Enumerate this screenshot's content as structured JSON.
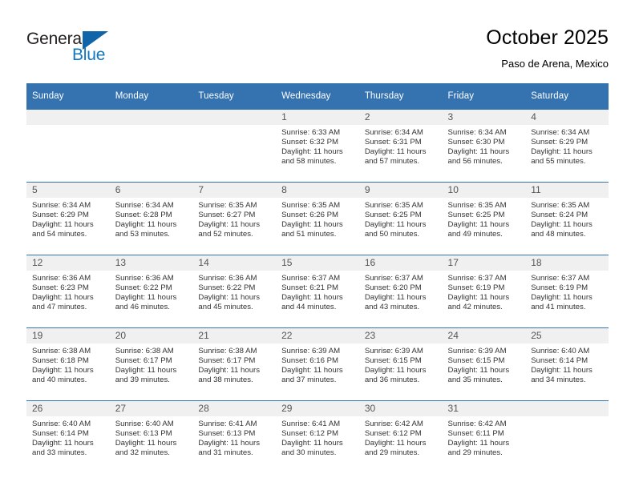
{
  "brand": {
    "name_part1": "General",
    "name_part2": "Blue",
    "triangle_icon": "triangle-logo-icon",
    "accent_color": "#1064a8",
    "blue_text_color": "#1278be"
  },
  "header": {
    "title": "October 2025",
    "subtitle": "Paso de Arena, Mexico",
    "header_bg_color": "#3572b0",
    "daynum_band_color": "#f0f0f0"
  },
  "weekday_headers": [
    "Sunday",
    "Monday",
    "Tuesday",
    "Wednesday",
    "Thursday",
    "Friday",
    "Saturday"
  ],
  "labels": {
    "sunrise_prefix": "Sunrise:",
    "sunset_prefix": "Sunset:",
    "daylight_prefix": "Daylight:"
  },
  "weeks": [
    [
      {
        "day": "",
        "empty": true,
        "sunrise": "",
        "sunset": "",
        "daylight_line1": "",
        "daylight_line2": ""
      },
      {
        "day": "",
        "empty": true,
        "sunrise": "",
        "sunset": "",
        "daylight_line1": "",
        "daylight_line2": ""
      },
      {
        "day": "",
        "empty": true,
        "sunrise": "",
        "sunset": "",
        "daylight_line1": "",
        "daylight_line2": ""
      },
      {
        "day": "1",
        "empty": false,
        "sunrise": "Sunrise: 6:33 AM",
        "sunset": "Sunset: 6:32 PM",
        "daylight_line1": "Daylight: 11 hours",
        "daylight_line2": "and 58 minutes."
      },
      {
        "day": "2",
        "empty": false,
        "sunrise": "Sunrise: 6:34 AM",
        "sunset": "Sunset: 6:31 PM",
        "daylight_line1": "Daylight: 11 hours",
        "daylight_line2": "and 57 minutes."
      },
      {
        "day": "3",
        "empty": false,
        "sunrise": "Sunrise: 6:34 AM",
        "sunset": "Sunset: 6:30 PM",
        "daylight_line1": "Daylight: 11 hours",
        "daylight_line2": "and 56 minutes."
      },
      {
        "day": "4",
        "empty": false,
        "sunrise": "Sunrise: 6:34 AM",
        "sunset": "Sunset: 6:29 PM",
        "daylight_line1": "Daylight: 11 hours",
        "daylight_line2": "and 55 minutes."
      }
    ],
    [
      {
        "day": "5",
        "empty": false,
        "sunrise": "Sunrise: 6:34 AM",
        "sunset": "Sunset: 6:29 PM",
        "daylight_line1": "Daylight: 11 hours",
        "daylight_line2": "and 54 minutes."
      },
      {
        "day": "6",
        "empty": false,
        "sunrise": "Sunrise: 6:34 AM",
        "sunset": "Sunset: 6:28 PM",
        "daylight_line1": "Daylight: 11 hours",
        "daylight_line2": "and 53 minutes."
      },
      {
        "day": "7",
        "empty": false,
        "sunrise": "Sunrise: 6:35 AM",
        "sunset": "Sunset: 6:27 PM",
        "daylight_line1": "Daylight: 11 hours",
        "daylight_line2": "and 52 minutes."
      },
      {
        "day": "8",
        "empty": false,
        "sunrise": "Sunrise: 6:35 AM",
        "sunset": "Sunset: 6:26 PM",
        "daylight_line1": "Daylight: 11 hours",
        "daylight_line2": "and 51 minutes."
      },
      {
        "day": "9",
        "empty": false,
        "sunrise": "Sunrise: 6:35 AM",
        "sunset": "Sunset: 6:25 PM",
        "daylight_line1": "Daylight: 11 hours",
        "daylight_line2": "and 50 minutes."
      },
      {
        "day": "10",
        "empty": false,
        "sunrise": "Sunrise: 6:35 AM",
        "sunset": "Sunset: 6:25 PM",
        "daylight_line1": "Daylight: 11 hours",
        "daylight_line2": "and 49 minutes."
      },
      {
        "day": "11",
        "empty": false,
        "sunrise": "Sunrise: 6:35 AM",
        "sunset": "Sunset: 6:24 PM",
        "daylight_line1": "Daylight: 11 hours",
        "daylight_line2": "and 48 minutes."
      }
    ],
    [
      {
        "day": "12",
        "empty": false,
        "sunrise": "Sunrise: 6:36 AM",
        "sunset": "Sunset: 6:23 PM",
        "daylight_line1": "Daylight: 11 hours",
        "daylight_line2": "and 47 minutes."
      },
      {
        "day": "13",
        "empty": false,
        "sunrise": "Sunrise: 6:36 AM",
        "sunset": "Sunset: 6:22 PM",
        "daylight_line1": "Daylight: 11 hours",
        "daylight_line2": "and 46 minutes."
      },
      {
        "day": "14",
        "empty": false,
        "sunrise": "Sunrise: 6:36 AM",
        "sunset": "Sunset: 6:22 PM",
        "daylight_line1": "Daylight: 11 hours",
        "daylight_line2": "and 45 minutes."
      },
      {
        "day": "15",
        "empty": false,
        "sunrise": "Sunrise: 6:37 AM",
        "sunset": "Sunset: 6:21 PM",
        "daylight_line1": "Daylight: 11 hours",
        "daylight_line2": "and 44 minutes."
      },
      {
        "day": "16",
        "empty": false,
        "sunrise": "Sunrise: 6:37 AM",
        "sunset": "Sunset: 6:20 PM",
        "daylight_line1": "Daylight: 11 hours",
        "daylight_line2": "and 43 minutes."
      },
      {
        "day": "17",
        "empty": false,
        "sunrise": "Sunrise: 6:37 AM",
        "sunset": "Sunset: 6:19 PM",
        "daylight_line1": "Daylight: 11 hours",
        "daylight_line2": "and 42 minutes."
      },
      {
        "day": "18",
        "empty": false,
        "sunrise": "Sunrise: 6:37 AM",
        "sunset": "Sunset: 6:19 PM",
        "daylight_line1": "Daylight: 11 hours",
        "daylight_line2": "and 41 minutes."
      }
    ],
    [
      {
        "day": "19",
        "empty": false,
        "sunrise": "Sunrise: 6:38 AM",
        "sunset": "Sunset: 6:18 PM",
        "daylight_line1": "Daylight: 11 hours",
        "daylight_line2": "and 40 minutes."
      },
      {
        "day": "20",
        "empty": false,
        "sunrise": "Sunrise: 6:38 AM",
        "sunset": "Sunset: 6:17 PM",
        "daylight_line1": "Daylight: 11 hours",
        "daylight_line2": "and 39 minutes."
      },
      {
        "day": "21",
        "empty": false,
        "sunrise": "Sunrise: 6:38 AM",
        "sunset": "Sunset: 6:17 PM",
        "daylight_line1": "Daylight: 11 hours",
        "daylight_line2": "and 38 minutes."
      },
      {
        "day": "22",
        "empty": false,
        "sunrise": "Sunrise: 6:39 AM",
        "sunset": "Sunset: 6:16 PM",
        "daylight_line1": "Daylight: 11 hours",
        "daylight_line2": "and 37 minutes."
      },
      {
        "day": "23",
        "empty": false,
        "sunrise": "Sunrise: 6:39 AM",
        "sunset": "Sunset: 6:15 PM",
        "daylight_line1": "Daylight: 11 hours",
        "daylight_line2": "and 36 minutes."
      },
      {
        "day": "24",
        "empty": false,
        "sunrise": "Sunrise: 6:39 AM",
        "sunset": "Sunset: 6:15 PM",
        "daylight_line1": "Daylight: 11 hours",
        "daylight_line2": "and 35 minutes."
      },
      {
        "day": "25",
        "empty": false,
        "sunrise": "Sunrise: 6:40 AM",
        "sunset": "Sunset: 6:14 PM",
        "daylight_line1": "Daylight: 11 hours",
        "daylight_line2": "and 34 minutes."
      }
    ],
    [
      {
        "day": "26",
        "empty": false,
        "sunrise": "Sunrise: 6:40 AM",
        "sunset": "Sunset: 6:14 PM",
        "daylight_line1": "Daylight: 11 hours",
        "daylight_line2": "and 33 minutes."
      },
      {
        "day": "27",
        "empty": false,
        "sunrise": "Sunrise: 6:40 AM",
        "sunset": "Sunset: 6:13 PM",
        "daylight_line1": "Daylight: 11 hours",
        "daylight_line2": "and 32 minutes."
      },
      {
        "day": "28",
        "empty": false,
        "sunrise": "Sunrise: 6:41 AM",
        "sunset": "Sunset: 6:13 PM",
        "daylight_line1": "Daylight: 11 hours",
        "daylight_line2": "and 31 minutes."
      },
      {
        "day": "29",
        "empty": false,
        "sunrise": "Sunrise: 6:41 AM",
        "sunset": "Sunset: 6:12 PM",
        "daylight_line1": "Daylight: 11 hours",
        "daylight_line2": "and 30 minutes."
      },
      {
        "day": "30",
        "empty": false,
        "sunrise": "Sunrise: 6:42 AM",
        "sunset": "Sunset: 6:12 PM",
        "daylight_line1": "Daylight: 11 hours",
        "daylight_line2": "and 29 minutes."
      },
      {
        "day": "31",
        "empty": false,
        "sunrise": "Sunrise: 6:42 AM",
        "sunset": "Sunset: 6:11 PM",
        "daylight_line1": "Daylight: 11 hours",
        "daylight_line2": "and 29 minutes."
      },
      {
        "day": "",
        "empty": true,
        "sunrise": "",
        "sunset": "",
        "daylight_line1": "",
        "daylight_line2": ""
      }
    ]
  ]
}
